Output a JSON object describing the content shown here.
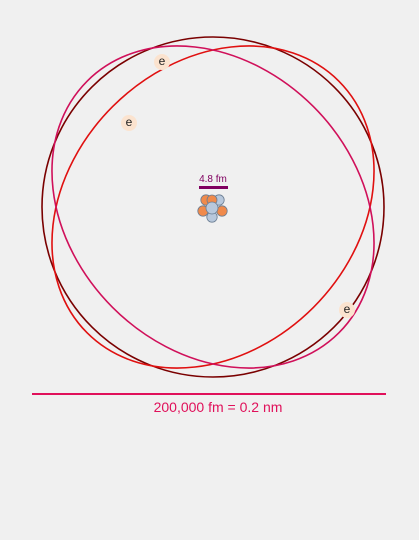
{
  "atom": {
    "electron_symbol": "e",
    "nucleus_scale_label": "4.8 fm",
    "atom_scale_label": "200,000 fm = 0.2 nm"
  },
  "colors": {
    "background": "#f0f0f0",
    "orbit_dark_red": "#7a0000",
    "orbit_red": "#e01010",
    "orbit_magenta": "#d0105a",
    "scale_bar_purple": "#800060",
    "scale_bar_pink": "#e0105a",
    "proton": "#f08a4b",
    "neutron": "#b8c8dc",
    "electron_fill": "#fbe3cf"
  },
  "icons": {
    "nucleus": "nucleus-icon",
    "electron": "electron-icon"
  }
}
